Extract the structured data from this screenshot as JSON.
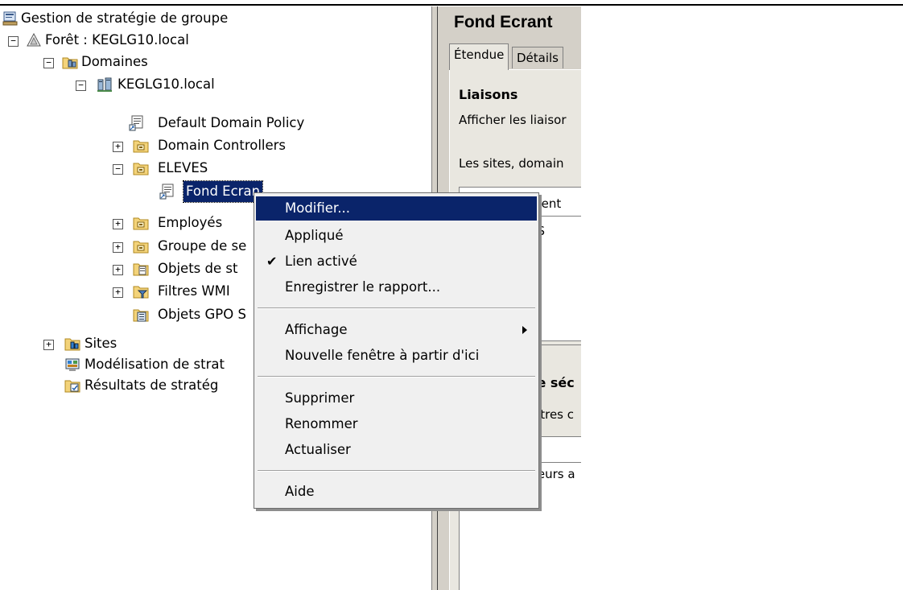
{
  "tree": {
    "root": "Gestion de stratégie de groupe",
    "forest": "Forêt : KEGLG10.local",
    "domains": "Domaines",
    "domain": "KEGLG10.local",
    "default_policy": "Default Domain Policy",
    "domain_controllers": "Domain Controllers",
    "eleves": "ELEVES",
    "fond_ecran": "Fond Ecran",
    "employes": "Employés",
    "groupe": "Groupe de se",
    "objets_strat": "Objets de st",
    "filtres": "Filtres WMI",
    "objets_gpo": "Objets GPO S",
    "sites": "Sites",
    "modelisation": "Modélisation de strat",
    "resultats": "Résultats de stratég",
    "expand_plus": "+",
    "expand_minus": "−"
  },
  "right": {
    "title": "Fond Ecrant",
    "tab_etendue": "Étendue",
    "tab_details": "Détails",
    "liaisons": "Liaisons",
    "afficher": "Afficher les liaisor",
    "les_sites": "Les sites, domain",
    "col_emplacement": "ment",
    "row_value": "ES",
    "filtrage": "le séc",
    "parametres": "ètres c",
    "utilisateurs": "teurs a"
  },
  "menu": {
    "modifier": "Modifier...",
    "applique": "Appliqué",
    "lien_active": "Lien activé",
    "check_mark": "✔",
    "enregistrer": "Enregistrer le rapport...",
    "affichage": "Affichage",
    "nouvelle_fenetre": "Nouvelle fenêtre à partir d'ici",
    "supprimer": "Supprimer",
    "renommer": "Renommer",
    "actualiser": "Actualiser",
    "aide": "Aide"
  }
}
